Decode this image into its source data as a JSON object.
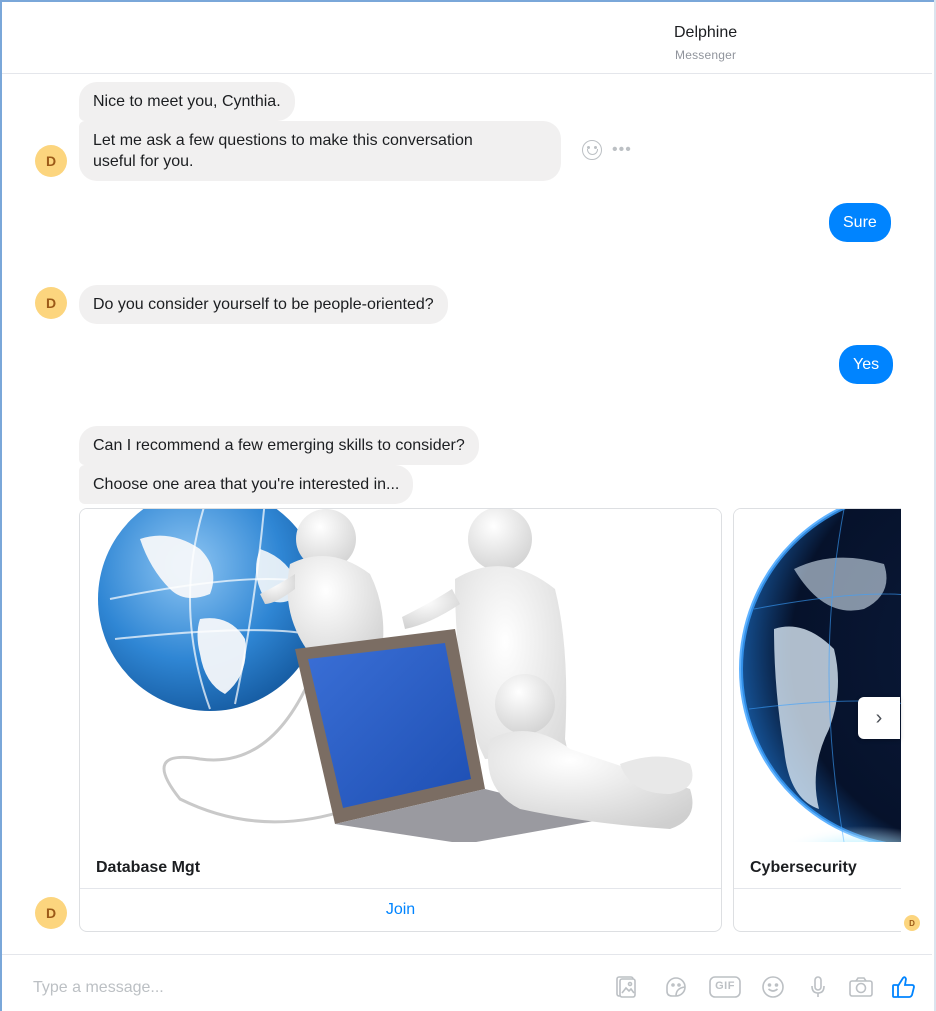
{
  "header": {
    "name": "Delphine",
    "subtitle": "Messenger"
  },
  "avatar_letter": "D",
  "messages": {
    "m1": "Nice to meet you, Cynthia.",
    "m2_line1": "Let me ask a few questions to make this conversation",
    "m2_line2": "useful for you.",
    "reply_sure": "Sure",
    "m3": "Do you consider yourself to be people-oriented?",
    "reply_yes": "Yes",
    "m4": "Can I recommend a few emerging skills to consider?",
    "m5": "Choose one area that you're interested in..."
  },
  "cards": [
    {
      "title": "Database Mgt",
      "action": "Join"
    },
    {
      "title": "Cybersecurity",
      "action": ""
    }
  ],
  "composer": {
    "placeholder": "Type a message...",
    "tools": [
      "photo-icon",
      "sticker-icon",
      "gif-icon",
      "emoji-icon",
      "microphone-icon",
      "camera-icon",
      "thumbs-up-icon"
    ],
    "gif_label": "GIF"
  },
  "colors": {
    "accent": "#0084ff",
    "bubble": "#f1f0f0",
    "avatar": "#fcd57e"
  }
}
